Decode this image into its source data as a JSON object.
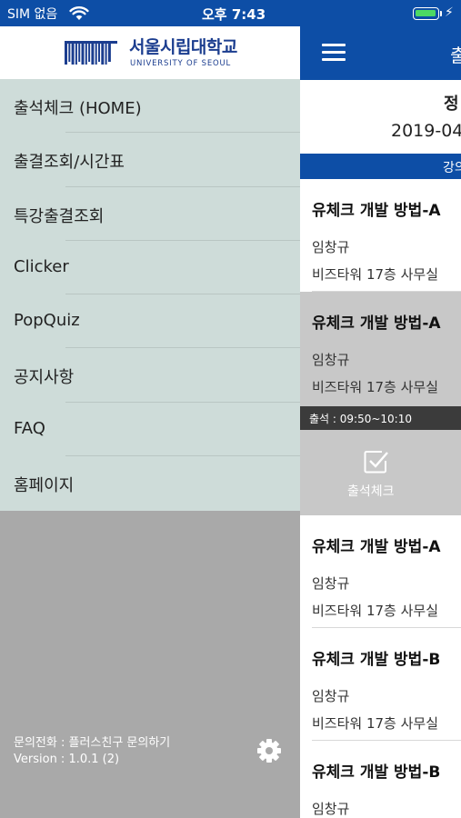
{
  "status_bar": {
    "carrier": "SIM 없음",
    "time": "오후 7:43"
  },
  "logo": {
    "name_kr": "서울시립대학교",
    "name_en": "UNIVERSITY OF SEOUL"
  },
  "drawer": {
    "menu": [
      {
        "label": "출석체크 (HOME)"
      },
      {
        "label": "출결조회/시간표"
      },
      {
        "label": "특강출결조회"
      },
      {
        "label": "Clicker"
      },
      {
        "label": "PopQuiz"
      },
      {
        "label": "공지사항"
      },
      {
        "label": "FAQ"
      },
      {
        "label": "홈페이지"
      }
    ],
    "footer": {
      "contact": "문의전화 :  플러스친구 문의하기",
      "version": "Version :  1.0.1 (2)"
    }
  },
  "main": {
    "header_title": "출",
    "info_name": "정",
    "info_date": "2019-04",
    "section_label": "강의",
    "lectures": [
      {
        "title": "유체크 개발 방법-A",
        "professor": "임창규",
        "room": "비즈타워 17층 사무실"
      },
      {
        "title": "유체크 개발 방법-A",
        "professor": "임창규",
        "room": "비즈타워 17층 사무실"
      },
      {
        "title": "유체크 개발 방법-A",
        "professor": "임창규",
        "room": "비즈타워 17층 사무실"
      },
      {
        "title": "유체크 개발 방법-B",
        "professor": "임창규",
        "room": "비즈타워 17층 사무실"
      },
      {
        "title": "유체크 개발 방법-B",
        "professor": "임창규",
        "room": ""
      }
    ],
    "attendance_time": "출석 :    09:50~10:10",
    "check_label": "출석체크"
  },
  "colors": {
    "primary": "#0d4ea6",
    "drawer_menu_bg": "#cedcd9",
    "drawer_footer_bg": "#a9a9a9",
    "active_lecture_bg": "#c8c8c8",
    "battery": "#4cd964"
  },
  "icons": [
    "wifi-icon",
    "battery-icon",
    "charge-icon",
    "hamburger-menu-icon",
    "checkbox-icon",
    "gear-icon",
    "university-logo-icon"
  ]
}
